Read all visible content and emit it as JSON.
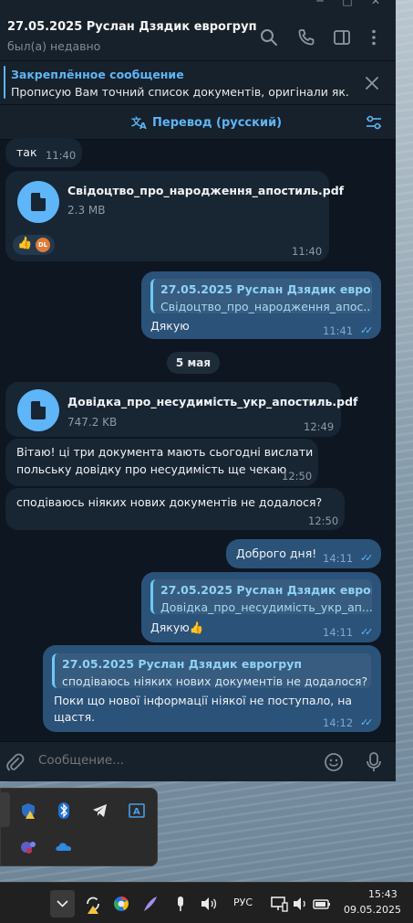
{
  "chat": {
    "title": "27.05.2025 Руслан Дзядик еврогруп",
    "status": "был(а) недавно"
  },
  "pinned": {
    "title": "Закреплённое сообщение",
    "text": "Прописую Вам точний список документів, оригінали як..."
  },
  "translate": {
    "label": "Перевод (русский)"
  },
  "messages": {
    "m1": {
      "text": "так",
      "time": "11:40"
    },
    "m2": {
      "file_name": "Свідоцтво_про_народження_апостиль.pdf",
      "file_size": "2.3 MB",
      "time": "11:40",
      "reaction": "👍",
      "reaction_avatar": "DL"
    },
    "m3": {
      "reply_title": "27.05.2025 Руслан Дзядик еврогруп",
      "reply_text": "Свідоцтво_про_народження_апос...",
      "text": "Дякую",
      "time": "11:41"
    },
    "date_separator": "5 мая",
    "m4": {
      "file_name": "Довідка_про_несудимість_укр_апостиль.pdf",
      "file_size": "747.2 KB",
      "time": "12:49"
    },
    "m5": {
      "line1": "Вітаю! ці три документа мають сьогодні вислати",
      "line2": "польську довідку про несудимість ще чекаю",
      "time": "12:50"
    },
    "m6": {
      "text": "сподіваюсь ніяких нових документів не додалося?",
      "time": "12:50"
    },
    "m7": {
      "text": "Доброго дня!",
      "time": "14:11"
    },
    "m8": {
      "reply_title": "27.05.2025 Руслан Дзядик еврогруп",
      "reply_text": "Довідка_про_несудимість_укр_ап...",
      "text": "Дякую👍",
      "time": "14:11"
    },
    "m9": {
      "reply_title": "27.05.2025 Руслан Дзядик еврогруп",
      "reply_text": "сподіваюсь ніяких нових документів не додалося?",
      "line1": "Поки що нової інформації ніякої не поступало, на",
      "line2": "щастя.",
      "time": "14:12"
    }
  },
  "composer": {
    "placeholder": "Сообщение..."
  },
  "taskbar": {
    "language": "РУС",
    "time": "15:43",
    "date": "09.05.2025"
  },
  "colors": {
    "accent": "#5eb5f7",
    "outgoing_bubble": "#2b5278",
    "incoming_bubble": "#182533",
    "chat_bg": "#0e1621"
  }
}
